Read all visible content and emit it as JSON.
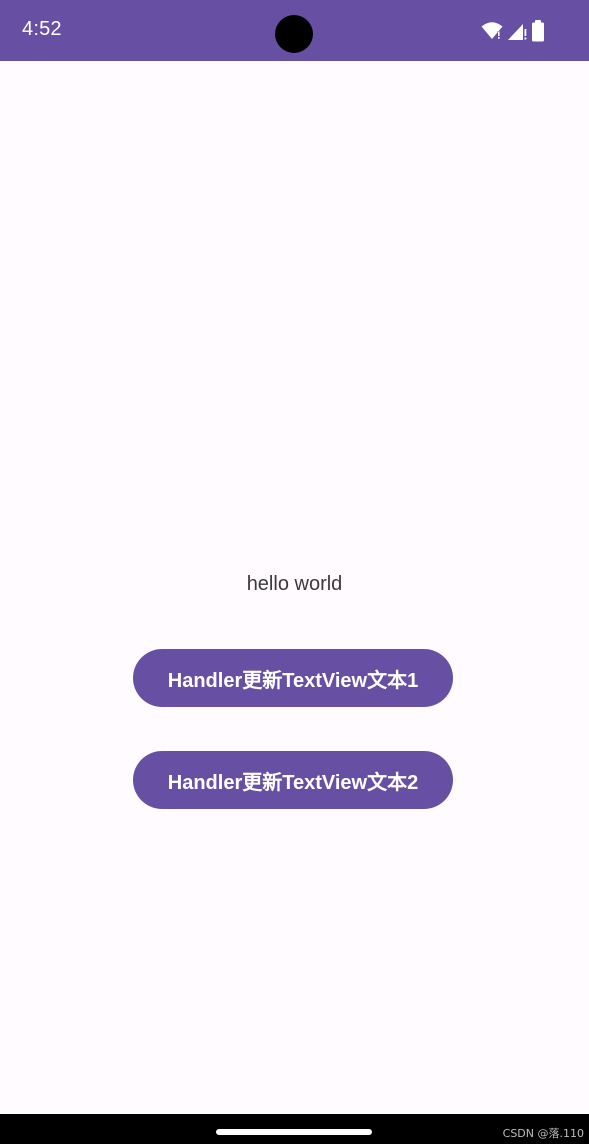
{
  "status_bar": {
    "time": "4:52",
    "background_color": "#6750a4",
    "icons": [
      "wifi-icon",
      "signal-icon",
      "battery-icon"
    ]
  },
  "main": {
    "text": "hello world",
    "buttons": [
      {
        "label": "Handler更新TextView文本1"
      },
      {
        "label": "Handler更新TextView文本2"
      }
    ],
    "button_color": "#6750a4"
  },
  "watermark": "CSDN @落.110"
}
